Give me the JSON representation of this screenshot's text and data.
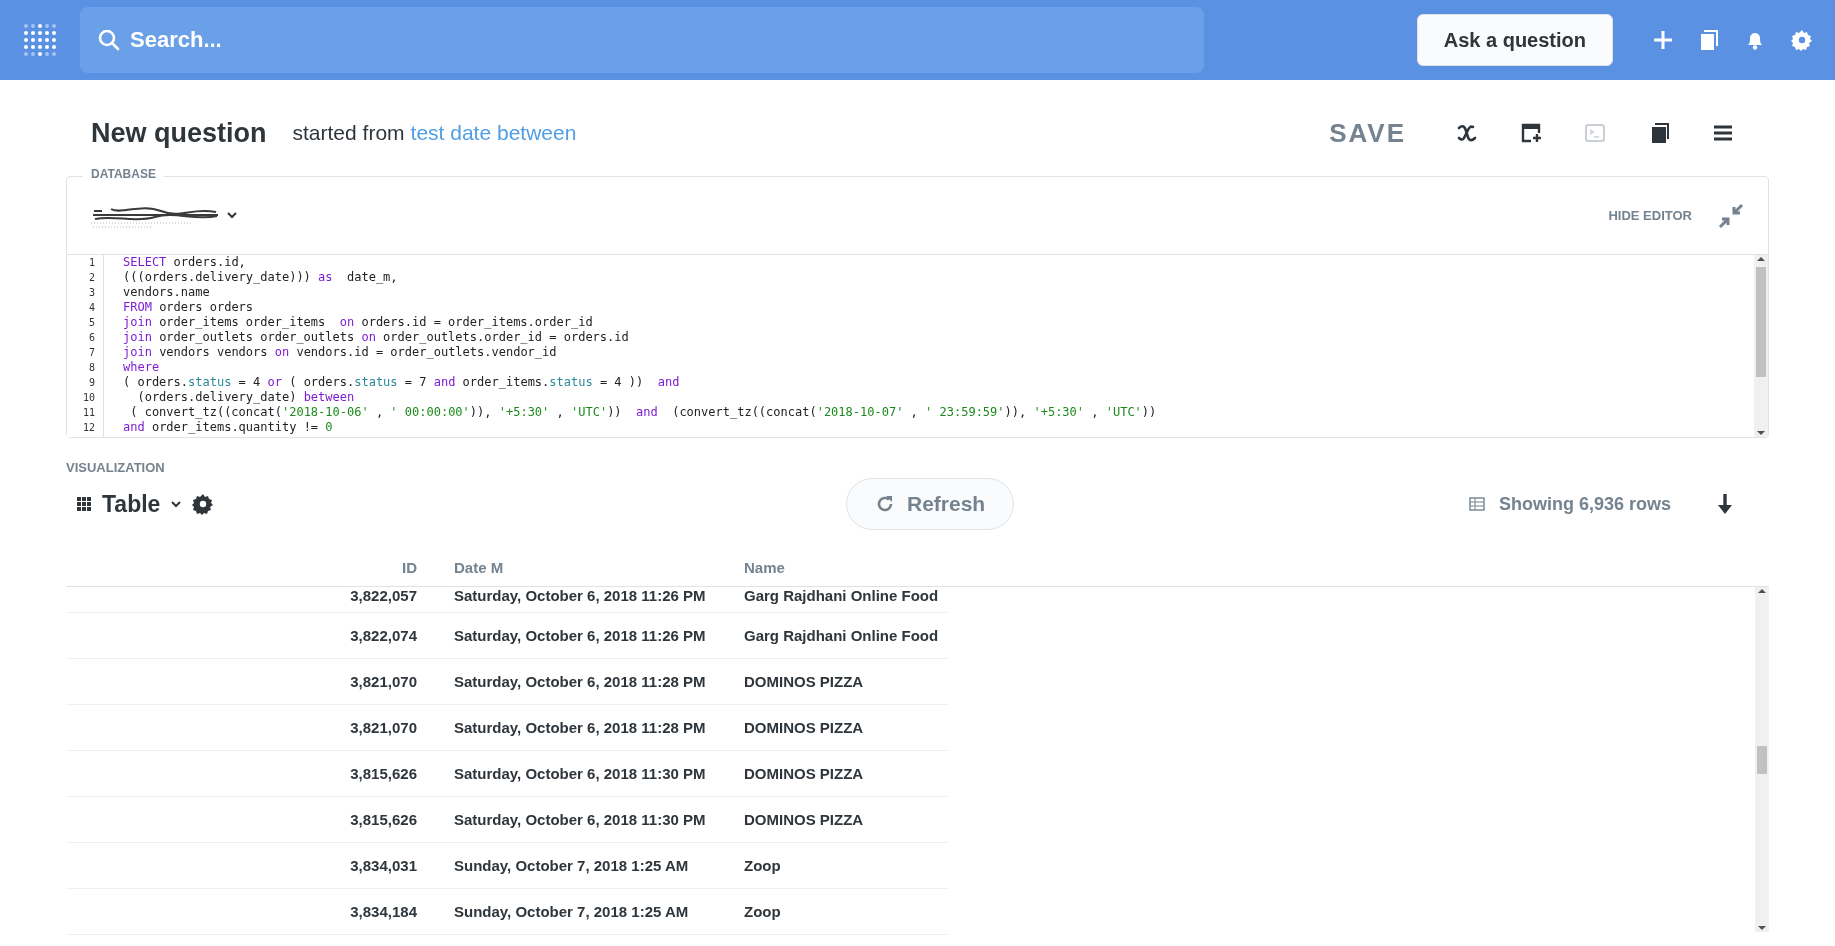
{
  "nav": {
    "search_placeholder": "Search...",
    "ask_button": "Ask a question"
  },
  "question": {
    "title": "New question",
    "started_from": "started from",
    "source_link": "test date between"
  },
  "toolbar": {
    "save": "SAVE",
    "icons": [
      {
        "kind": "variables",
        "disabled": false
      },
      {
        "kind": "add-to-dashboard",
        "disabled": false
      },
      {
        "kind": "snippet",
        "disabled": true
      },
      {
        "kind": "collection",
        "disabled": false
      },
      {
        "kind": "menu",
        "disabled": false
      }
    ]
  },
  "editor": {
    "database_label": "DATABASE",
    "hide_editor": "HIDE EDITOR",
    "lines": [
      {
        "num": "1",
        "tokens": [
          {
            "t": "SELECT",
            "kind": "kw"
          },
          {
            "t": " orders.id,"
          }
        ]
      },
      {
        "num": "2",
        "tokens": [
          {
            "t": "(((orders.delivery_date))) "
          },
          {
            "t": "as",
            "kind": "kw"
          },
          {
            "t": "  date_m,"
          }
        ]
      },
      {
        "num": "3",
        "tokens": [
          {
            "t": "vendors.name"
          }
        ]
      },
      {
        "num": "4",
        "tokens": [
          {
            "t": "FROM",
            "kind": "kw"
          },
          {
            "t": " orders orders"
          }
        ]
      },
      {
        "num": "5",
        "tokens": [
          {
            "t": "join",
            "kind": "kw"
          },
          {
            "t": " order_items order_items  "
          },
          {
            "t": "on",
            "kind": "kw"
          },
          {
            "t": " orders.id = order_items.order_id"
          }
        ]
      },
      {
        "num": "6",
        "tokens": [
          {
            "t": "join",
            "kind": "kw"
          },
          {
            "t": " order_outlets order_outlets "
          },
          {
            "t": "on",
            "kind": "kw"
          },
          {
            "t": " order_outlets.order_id = orders.id"
          }
        ]
      },
      {
        "num": "7",
        "tokens": [
          {
            "t": "join",
            "kind": "kw"
          },
          {
            "t": " vendors vendors "
          },
          {
            "t": "on",
            "kind": "kw"
          },
          {
            "t": " vendors.id = order_outlets.vendor_id"
          }
        ]
      },
      {
        "num": "8",
        "tokens": [
          {
            "t": "where",
            "kind": "kw"
          }
        ]
      },
      {
        "num": "9",
        "tokens": [
          {
            "t": "( orders."
          },
          {
            "t": "status",
            "kind": "field"
          },
          {
            "t": " = 4 "
          },
          {
            "t": "or",
            "kind": "kw"
          },
          {
            "t": " ( orders."
          },
          {
            "t": "status",
            "kind": "field"
          },
          {
            "t": " = 7 "
          },
          {
            "t": "and",
            "kind": "kw"
          },
          {
            "t": " order_items."
          },
          {
            "t": "status",
            "kind": "field"
          },
          {
            "t": " = 4 ))  "
          },
          {
            "t": "and",
            "kind": "kw"
          }
        ]
      },
      {
        "num": "10",
        "tokens": [
          {
            "t": "  (orders.delivery_date) "
          },
          {
            "t": "between",
            "kind": "kw"
          }
        ]
      },
      {
        "num": "11",
        "tokens": [
          {
            "t": " ( convert_tz((concat("
          },
          {
            "t": "'2018-10-06'",
            "kind": "str"
          },
          {
            "t": " , "
          },
          {
            "t": "' 00:00:00'",
            "kind": "str"
          },
          {
            "t": ")), "
          },
          {
            "t": "'+5:30'",
            "kind": "str"
          },
          {
            "t": " , "
          },
          {
            "t": "'UTC'",
            "kind": "str"
          },
          {
            "t": "))  "
          },
          {
            "t": "and",
            "kind": "kw"
          },
          {
            "t": "  (convert_tz((concat("
          },
          {
            "t": "'2018-10-07'",
            "kind": "str"
          },
          {
            "t": " , "
          },
          {
            "t": "' 23:59:59'",
            "kind": "str"
          },
          {
            "t": ")), "
          },
          {
            "t": "'+5:30'",
            "kind": "str"
          },
          {
            "t": " , "
          },
          {
            "t": "'UTC'",
            "kind": "str"
          },
          {
            "t": "))"
          }
        ]
      },
      {
        "num": "12",
        "tokens": [
          {
            "t": "and",
            "kind": "kw"
          },
          {
            "t": " order_items.quantity != "
          },
          {
            "t": "0",
            "kind": "str"
          }
        ]
      }
    ]
  },
  "visualization": {
    "label": "VISUALIZATION",
    "type": "Table",
    "refresh": "Refresh",
    "row_count": "Showing 6,936 rows"
  },
  "table": {
    "columns": [
      "ID",
      "Date M",
      "Name"
    ],
    "rows": [
      [
        "3,822,057",
        "Saturday, October 6, 2018 11:26 PM",
        "Garg Rajdhani Online Food"
      ],
      [
        "3,822,074",
        "Saturday, October 6, 2018 11:26 PM",
        "Garg Rajdhani Online Food"
      ],
      [
        "3,821,070",
        "Saturday, October 6, 2018 11:28 PM",
        "DOMINOS PIZZA"
      ],
      [
        "3,821,070",
        "Saturday, October 6, 2018 11:28 PM",
        "DOMINOS PIZZA"
      ],
      [
        "3,815,626",
        "Saturday, October 6, 2018 11:30 PM",
        "DOMINOS PIZZA"
      ],
      [
        "3,815,626",
        "Saturday, October 6, 2018 11:30 PM",
        "DOMINOS PIZZA"
      ],
      [
        "3,834,031",
        "Sunday, October 7, 2018 1:25 AM",
        "Zoop"
      ],
      [
        "3,834,184",
        "Sunday, October 7, 2018 1:25 AM",
        "Zoop"
      ]
    ]
  }
}
